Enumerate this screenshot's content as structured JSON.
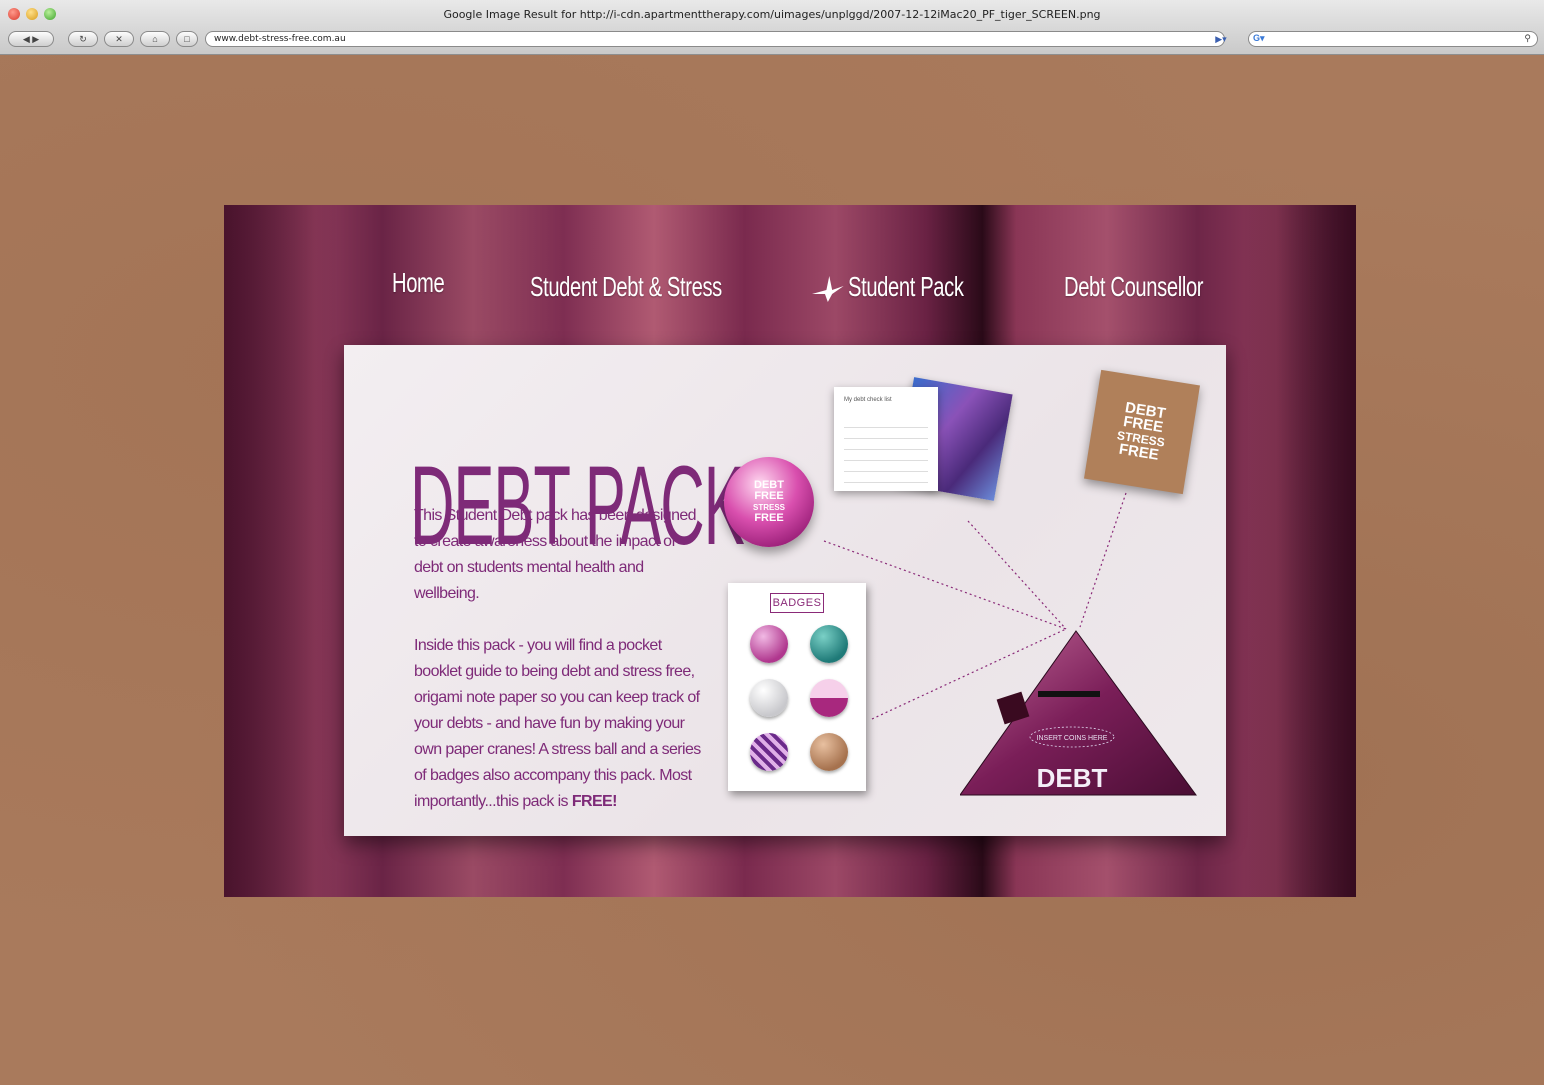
{
  "browser": {
    "window_title": "Google Image Result for http://i-cdn.apartmenttherapy.com/uimages/unplggd/2007-12-12iMac20_PF_tiger_SCREEN.png",
    "url": "www.debt-stress-free.com.au"
  },
  "nav": {
    "items": [
      {
        "label": "Home"
      },
      {
        "label": "Student Debt & Stress"
      },
      {
        "label": "Student Pack"
      },
      {
        "label": "Debt Counsellor"
      }
    ]
  },
  "content": {
    "title": "DEBT PACK",
    "paragraph1": "This Student Debt pack has been designed to create awareness about the impact of debt on students mental health and wellbeing.",
    "paragraph2": "Inside this pack - you will find a pocket booklet guide to being debt and stress free, origami note paper so you can keep track of your debts - and have fun by making your own paper cranes! A stress ball and a series of badges also accompany this pack. Most importantly...this pack is",
    "paragraph2_emphasis": "FREE!"
  },
  "products": {
    "stress_ball": [
      "DEBT",
      "FREE",
      "STRESS",
      "FREE"
    ],
    "notepaper_heading": "My debt check list",
    "booklet": [
      "DEBT",
      "FREE",
      "STRESS",
      "FREE"
    ],
    "badges_label": "BADGES",
    "debt_box_label": "DEBT",
    "debt_box_subtitle": "INSERT COINS HERE"
  },
  "colors": {
    "accent": "#7e2a78",
    "card_bg": "#ede6ea",
    "page_bg": "#a97a5c"
  }
}
